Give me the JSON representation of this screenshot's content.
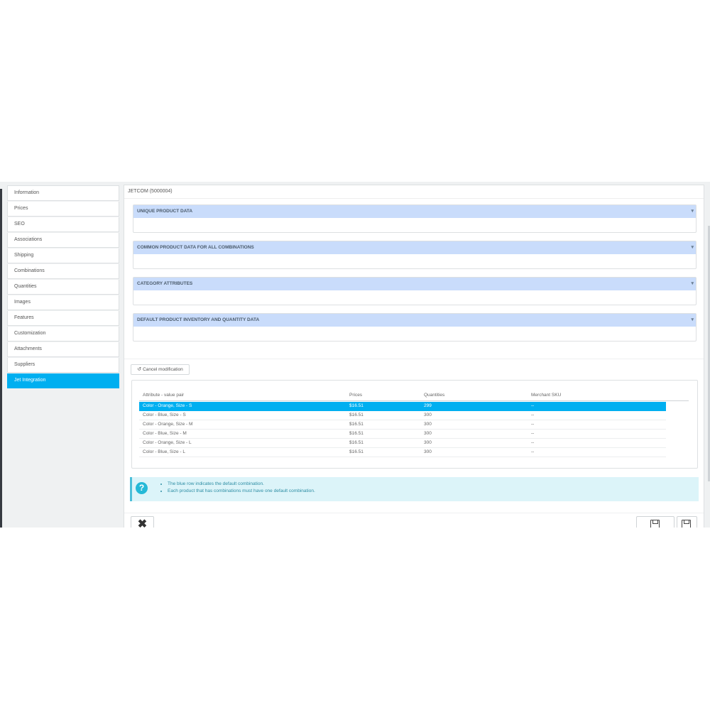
{
  "sidebar": {
    "items": [
      {
        "label": "Information"
      },
      {
        "label": "Prices"
      },
      {
        "label": "SEO"
      },
      {
        "label": "Associations"
      },
      {
        "label": "Shipping"
      },
      {
        "label": "Combinations"
      },
      {
        "label": "Quantities"
      },
      {
        "label": "Images"
      },
      {
        "label": "Features"
      },
      {
        "label": "Customization"
      },
      {
        "label": "Attachments"
      },
      {
        "label": "Suppliers"
      },
      {
        "label": "Jet Integration"
      }
    ],
    "active_index": 12,
    "active_color": "#00aff0"
  },
  "panel": {
    "heading": "JETCOM (5000004)",
    "sections": [
      {
        "title": "UNIQUE PRODUCT DATA",
        "caret": "▾"
      },
      {
        "title": "COMMON PRODUCT DATA FOR ALL COMBINATIONS",
        "caret": "▾"
      },
      {
        "title": "CATEGORY ATTRIBUTES",
        "caret": "▾"
      },
      {
        "title": "DEFAULT PRODUCT INVENTORY AND QUANTITY DATA",
        "caret": "▾"
      }
    ],
    "section_header_color": "#c9dcfb"
  },
  "cancel_button": {
    "icon": "undo-icon",
    "icon_glyph": "↺",
    "label": "Cancel modification"
  },
  "combinations_table": {
    "headers": {
      "attribute": "Attribute - value pair",
      "prices": "Prices",
      "quantities": "Quantities",
      "sku": "Merchant SKU"
    },
    "rows": [
      {
        "attribute": "Color - Orange, Size - S",
        "price": "$16.51",
        "quantity": "299",
        "sku": "--"
      },
      {
        "attribute": "Color - Blue, Size - S",
        "price": "$16.51",
        "quantity": "300",
        "sku": "--"
      },
      {
        "attribute": "Color - Orange, Size - M",
        "price": "$16.51",
        "quantity": "300",
        "sku": "--"
      },
      {
        "attribute": "Color - Blue, Size - M",
        "price": "$16.51",
        "quantity": "300",
        "sku": "--"
      },
      {
        "attribute": "Color - Orange, Size - L",
        "price": "$16.51",
        "quantity": "300",
        "sku": "--"
      },
      {
        "attribute": "Color - Blue, Size - L",
        "price": "$16.51",
        "quantity": "300",
        "sku": "--"
      }
    ],
    "selected_row_index": 0,
    "selected_row_color": "#00aff0"
  },
  "alert": {
    "icon": "question-icon",
    "icon_glyph": "?",
    "lines": [
      "The blue row indicates the default combination.",
      "Each product that has combinations must have one default combination."
    ]
  },
  "footer": {
    "close_icon": "close-icon",
    "close_glyph": "✖",
    "save_icon": "save-icon",
    "save_and_stay_icon": "save-icon"
  }
}
